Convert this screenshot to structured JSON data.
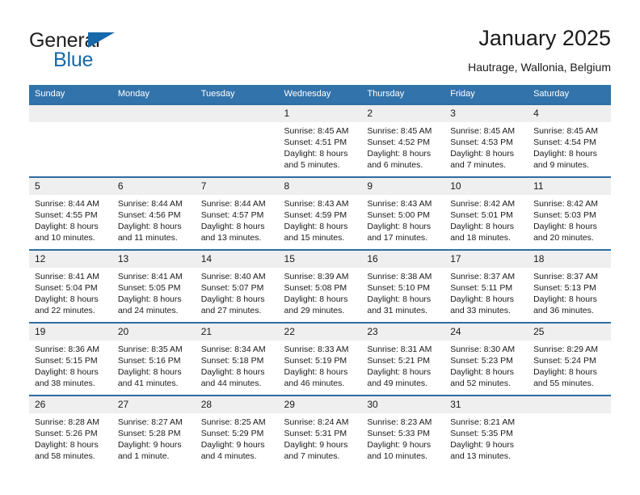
{
  "brand": {
    "name_part1": "General",
    "name_part2": "Blue",
    "triangle_color": "#1769aa"
  },
  "header": {
    "title": "January 2025",
    "location": "Hautrage, Wallonia, Belgium"
  },
  "theme": {
    "header_background": "#3273ab",
    "row_divider": "#2e6da4",
    "daynum_background": "#efefef",
    "text": "#1a1a1a"
  },
  "calendar": {
    "weekday_headers": [
      "Sunday",
      "Monday",
      "Tuesday",
      "Wednesday",
      "Thursday",
      "Friday",
      "Saturday"
    ],
    "labels": {
      "sunrise": "Sunrise:",
      "sunset": "Sunset:",
      "daylight": "Daylight:"
    },
    "weeks": [
      [
        {
          "day": "",
          "sunrise": "",
          "sunset": "",
          "daylight_line1": "",
          "daylight_line2": ""
        },
        {
          "day": "",
          "sunrise": "",
          "sunset": "",
          "daylight_line1": "",
          "daylight_line2": ""
        },
        {
          "day": "",
          "sunrise": "",
          "sunset": "",
          "daylight_line1": "",
          "daylight_line2": ""
        },
        {
          "day": "1",
          "sunrise": "Sunrise: 8:45 AM",
          "sunset": "Sunset: 4:51 PM",
          "daylight_line1": "Daylight: 8 hours",
          "daylight_line2": "and 5 minutes."
        },
        {
          "day": "2",
          "sunrise": "Sunrise: 8:45 AM",
          "sunset": "Sunset: 4:52 PM",
          "daylight_line1": "Daylight: 8 hours",
          "daylight_line2": "and 6 minutes."
        },
        {
          "day": "3",
          "sunrise": "Sunrise: 8:45 AM",
          "sunset": "Sunset: 4:53 PM",
          "daylight_line1": "Daylight: 8 hours",
          "daylight_line2": "and 7 minutes."
        },
        {
          "day": "4",
          "sunrise": "Sunrise: 8:45 AM",
          "sunset": "Sunset: 4:54 PM",
          "daylight_line1": "Daylight: 8 hours",
          "daylight_line2": "and 9 minutes."
        }
      ],
      [
        {
          "day": "5",
          "sunrise": "Sunrise: 8:44 AM",
          "sunset": "Sunset: 4:55 PM",
          "daylight_line1": "Daylight: 8 hours",
          "daylight_line2": "and 10 minutes."
        },
        {
          "day": "6",
          "sunrise": "Sunrise: 8:44 AM",
          "sunset": "Sunset: 4:56 PM",
          "daylight_line1": "Daylight: 8 hours",
          "daylight_line2": "and 11 minutes."
        },
        {
          "day": "7",
          "sunrise": "Sunrise: 8:44 AM",
          "sunset": "Sunset: 4:57 PM",
          "daylight_line1": "Daylight: 8 hours",
          "daylight_line2": "and 13 minutes."
        },
        {
          "day": "8",
          "sunrise": "Sunrise: 8:43 AM",
          "sunset": "Sunset: 4:59 PM",
          "daylight_line1": "Daylight: 8 hours",
          "daylight_line2": "and 15 minutes."
        },
        {
          "day": "9",
          "sunrise": "Sunrise: 8:43 AM",
          "sunset": "Sunset: 5:00 PM",
          "daylight_line1": "Daylight: 8 hours",
          "daylight_line2": "and 17 minutes."
        },
        {
          "day": "10",
          "sunrise": "Sunrise: 8:42 AM",
          "sunset": "Sunset: 5:01 PM",
          "daylight_line1": "Daylight: 8 hours",
          "daylight_line2": "and 18 minutes."
        },
        {
          "day": "11",
          "sunrise": "Sunrise: 8:42 AM",
          "sunset": "Sunset: 5:03 PM",
          "daylight_line1": "Daylight: 8 hours",
          "daylight_line2": "and 20 minutes."
        }
      ],
      [
        {
          "day": "12",
          "sunrise": "Sunrise: 8:41 AM",
          "sunset": "Sunset: 5:04 PM",
          "daylight_line1": "Daylight: 8 hours",
          "daylight_line2": "and 22 minutes."
        },
        {
          "day": "13",
          "sunrise": "Sunrise: 8:41 AM",
          "sunset": "Sunset: 5:05 PM",
          "daylight_line1": "Daylight: 8 hours",
          "daylight_line2": "and 24 minutes."
        },
        {
          "day": "14",
          "sunrise": "Sunrise: 8:40 AM",
          "sunset": "Sunset: 5:07 PM",
          "daylight_line1": "Daylight: 8 hours",
          "daylight_line2": "and 27 minutes."
        },
        {
          "day": "15",
          "sunrise": "Sunrise: 8:39 AM",
          "sunset": "Sunset: 5:08 PM",
          "daylight_line1": "Daylight: 8 hours",
          "daylight_line2": "and 29 minutes."
        },
        {
          "day": "16",
          "sunrise": "Sunrise: 8:38 AM",
          "sunset": "Sunset: 5:10 PM",
          "daylight_line1": "Daylight: 8 hours",
          "daylight_line2": "and 31 minutes."
        },
        {
          "day": "17",
          "sunrise": "Sunrise: 8:37 AM",
          "sunset": "Sunset: 5:11 PM",
          "daylight_line1": "Daylight: 8 hours",
          "daylight_line2": "and 33 minutes."
        },
        {
          "day": "18",
          "sunrise": "Sunrise: 8:37 AM",
          "sunset": "Sunset: 5:13 PM",
          "daylight_line1": "Daylight: 8 hours",
          "daylight_line2": "and 36 minutes."
        }
      ],
      [
        {
          "day": "19",
          "sunrise": "Sunrise: 8:36 AM",
          "sunset": "Sunset: 5:15 PM",
          "daylight_line1": "Daylight: 8 hours",
          "daylight_line2": "and 38 minutes."
        },
        {
          "day": "20",
          "sunrise": "Sunrise: 8:35 AM",
          "sunset": "Sunset: 5:16 PM",
          "daylight_line1": "Daylight: 8 hours",
          "daylight_line2": "and 41 minutes."
        },
        {
          "day": "21",
          "sunrise": "Sunrise: 8:34 AM",
          "sunset": "Sunset: 5:18 PM",
          "daylight_line1": "Daylight: 8 hours",
          "daylight_line2": "and 44 minutes."
        },
        {
          "day": "22",
          "sunrise": "Sunrise: 8:33 AM",
          "sunset": "Sunset: 5:19 PM",
          "daylight_line1": "Daylight: 8 hours",
          "daylight_line2": "and 46 minutes."
        },
        {
          "day": "23",
          "sunrise": "Sunrise: 8:31 AM",
          "sunset": "Sunset: 5:21 PM",
          "daylight_line1": "Daylight: 8 hours",
          "daylight_line2": "and 49 minutes."
        },
        {
          "day": "24",
          "sunrise": "Sunrise: 8:30 AM",
          "sunset": "Sunset: 5:23 PM",
          "daylight_line1": "Daylight: 8 hours",
          "daylight_line2": "and 52 minutes."
        },
        {
          "day": "25",
          "sunrise": "Sunrise: 8:29 AM",
          "sunset": "Sunset: 5:24 PM",
          "daylight_line1": "Daylight: 8 hours",
          "daylight_line2": "and 55 minutes."
        }
      ],
      [
        {
          "day": "26",
          "sunrise": "Sunrise: 8:28 AM",
          "sunset": "Sunset: 5:26 PM",
          "daylight_line1": "Daylight: 8 hours",
          "daylight_line2": "and 58 minutes."
        },
        {
          "day": "27",
          "sunrise": "Sunrise: 8:27 AM",
          "sunset": "Sunset: 5:28 PM",
          "daylight_line1": "Daylight: 9 hours",
          "daylight_line2": "and 1 minute."
        },
        {
          "day": "28",
          "sunrise": "Sunrise: 8:25 AM",
          "sunset": "Sunset: 5:29 PM",
          "daylight_line1": "Daylight: 9 hours",
          "daylight_line2": "and 4 minutes."
        },
        {
          "day": "29",
          "sunrise": "Sunrise: 8:24 AM",
          "sunset": "Sunset: 5:31 PM",
          "daylight_line1": "Daylight: 9 hours",
          "daylight_line2": "and 7 minutes."
        },
        {
          "day": "30",
          "sunrise": "Sunrise: 8:23 AM",
          "sunset": "Sunset: 5:33 PM",
          "daylight_line1": "Daylight: 9 hours",
          "daylight_line2": "and 10 minutes."
        },
        {
          "day": "31",
          "sunrise": "Sunrise: 8:21 AM",
          "sunset": "Sunset: 5:35 PM",
          "daylight_line1": "Daylight: 9 hours",
          "daylight_line2": "and 13 minutes."
        },
        {
          "day": "",
          "sunrise": "",
          "sunset": "",
          "daylight_line1": "",
          "daylight_line2": ""
        }
      ]
    ]
  }
}
